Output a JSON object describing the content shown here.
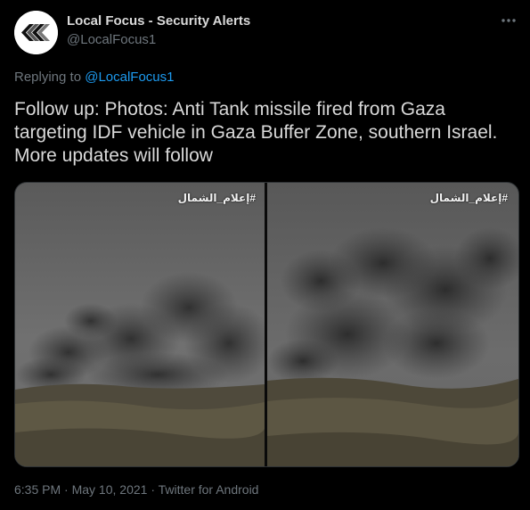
{
  "author": {
    "display_name": "Local Focus - Security Alerts",
    "handle": "@LocalFocus1",
    "avatar_icon": "chevron-logo-icon"
  },
  "reply": {
    "prefix": "Replying to",
    "mention": "@LocalFocus1"
  },
  "tweet": {
    "text": "Follow up: Photos: Anti Tank missile fired from Gaza targeting IDF vehicle in Gaza Buffer Zone, southern Israel. More updates will follow"
  },
  "media": {
    "images": [
      {
        "watermark": "#إعلام_الشمال"
      },
      {
        "watermark": "#إعلام_الشمال"
      }
    ]
  },
  "meta": {
    "time": "6:35 PM",
    "separator": "·",
    "date": "May 10, 2021",
    "source": "Twitter for Android"
  },
  "colors": {
    "background": "#000000",
    "text": "#d9d9d9",
    "muted": "#6e767d",
    "link": "#1d9bf0"
  },
  "icons": {
    "more": "more-horizontal-icon"
  }
}
